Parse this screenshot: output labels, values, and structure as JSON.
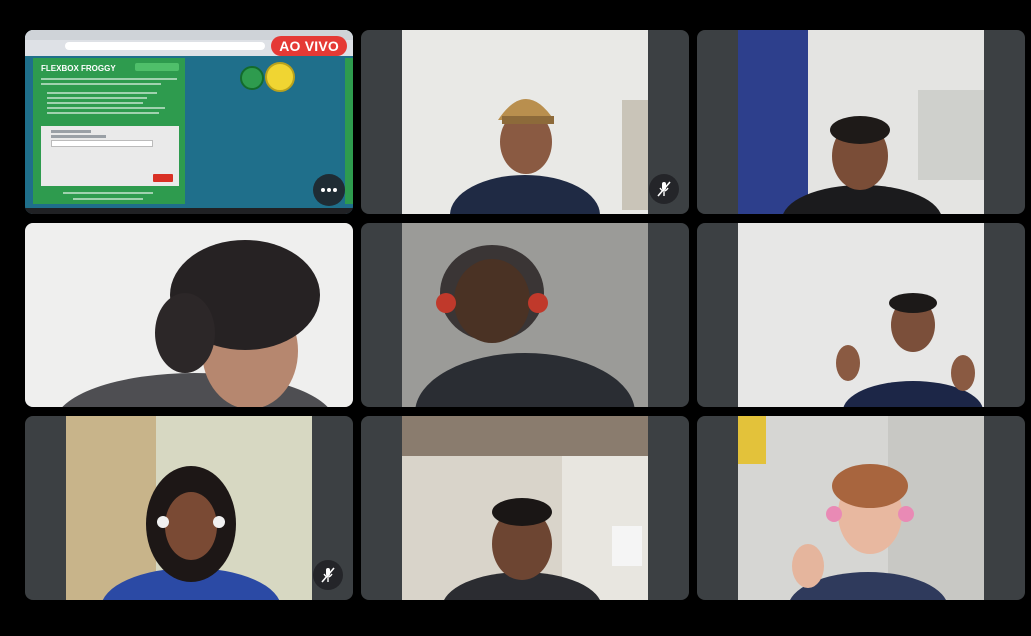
{
  "presentation": {
    "live_badge": "AO VIVO",
    "app_title": "FLEXBOX FROGGY"
  },
  "participants": [
    {
      "tile": "presentation",
      "muted": false
    },
    {
      "tile": "participant-1",
      "muted": true
    },
    {
      "tile": "participant-2",
      "muted": false
    },
    {
      "tile": "participant-3",
      "muted": false
    },
    {
      "tile": "participant-4",
      "muted": false
    },
    {
      "tile": "participant-5",
      "muted": false
    },
    {
      "tile": "participant-6",
      "muted": true
    },
    {
      "tile": "participant-7",
      "muted": false
    },
    {
      "tile": "participant-8",
      "muted": false
    }
  ],
  "colors": {
    "tile_bg": "#3c4043",
    "live_red": "#e53935",
    "froggy_green": "#2e9b4e",
    "pond_blue": "#1f6f8b"
  },
  "icons": {
    "mute": "mic-off-icon",
    "more": "more-options-icon"
  }
}
